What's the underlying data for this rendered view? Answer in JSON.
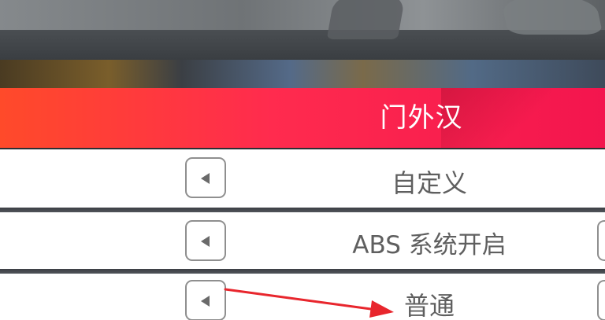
{
  "header": {
    "title": "门外汉"
  },
  "rows": [
    {
      "label": "自定义"
    },
    {
      "label": "ABS 系统开启"
    },
    {
      "label": "普通"
    }
  ],
  "icons": {
    "left_arrow": "left-triangle-icon",
    "annotation": "red-arrow-annotation"
  },
  "colors": {
    "header_start": "#ff4a2a",
    "header_end": "#f3154e",
    "row_bg": "#ffffff",
    "row_text": "#5f5f5f",
    "button_border": "#8f8f8f",
    "annotation": "#e8262d"
  }
}
